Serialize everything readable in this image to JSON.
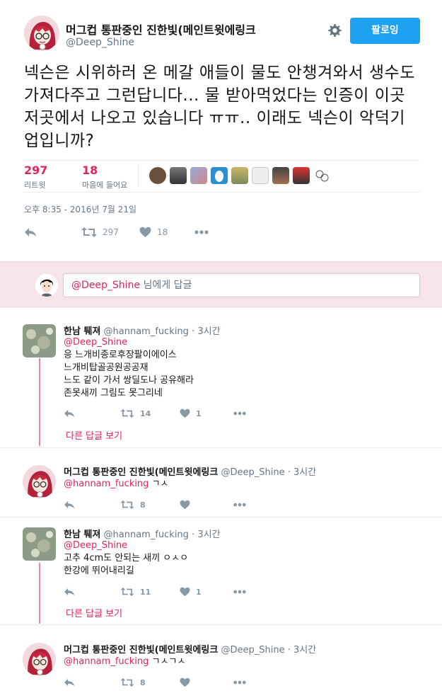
{
  "tweet": {
    "display_name": "머그컵 통판중인 진한빛(메인트윗에링크",
    "handle": "@Deep_Shine",
    "follow_label": "팔로잉",
    "text": "넥슨은 시위하러 온 메갈 애들이 물도 안챙겨와서 생수도 가져다주고 그런답니다... 물 받아먹었다는 인증이 이곳저곳에서 나오고 있습니다 ㅠㅠ.. 이래도 넥슨이 악덕기업입니까?",
    "retweets": {
      "count": "297",
      "label": "리트윗"
    },
    "likes": {
      "count": "18",
      "label": "마음에 들어요"
    },
    "timestamp": "오후 8:35 - 2016년 7월 21일",
    "actions": {
      "retweet_count": "297",
      "like_count": "18"
    }
  },
  "reply_box": {
    "mention": "@Deep_Shine",
    "suffix": " 님에게 답글"
  },
  "replies": [
    {
      "name": "한남 퉤져",
      "handle": "@hannam_fucking",
      "time": "3시간",
      "mention": "@Deep_Shine",
      "lines": [
        "응 느개비종로후장팔이에이스",
        "느개비탑골공원공공재",
        "느도 같이 가서 쌍딜도나 공유해라",
        "존못새끼 그림도 못그리네"
      ],
      "retweet_count": "14",
      "like_count": "1",
      "more": "다른 답글 보기"
    },
    {
      "name": "머그컵 통판중인 진한빛(메인트윗에링크",
      "handle": "@Deep_Shine",
      "time": "3시간",
      "mention": "@hannam_fucking",
      "lines": [
        "ㄱㅅ"
      ],
      "retweet_count": "8",
      "like_count": ""
    },
    {
      "name": "한남 퉤져",
      "handle": "@hannam_fucking",
      "time": "3시간",
      "mention": "@Deep_Shine",
      "lines": [
        "고추 4cm도 안되는 새끼 ㅇㅅㅇ",
        "한강에 뛰어내리길"
      ],
      "retweet_count": "11",
      "like_count": "1",
      "more": "다른 답글 보기"
    },
    {
      "name": "머그컵 통판중인 진한빛(메인트윗에링크",
      "handle": "@Deep_Shine",
      "time": "3시간",
      "mention": "@hannam_fucking",
      "lines": [
        "ㄱㅅㄱㅅ"
      ],
      "retweet_count": "8",
      "like_count": ""
    }
  ],
  "colors": {
    "accent": "#e0245e",
    "follow_button": "#1da1f2",
    "reply_bar": "#f5e4e8",
    "muted": "#657786"
  }
}
